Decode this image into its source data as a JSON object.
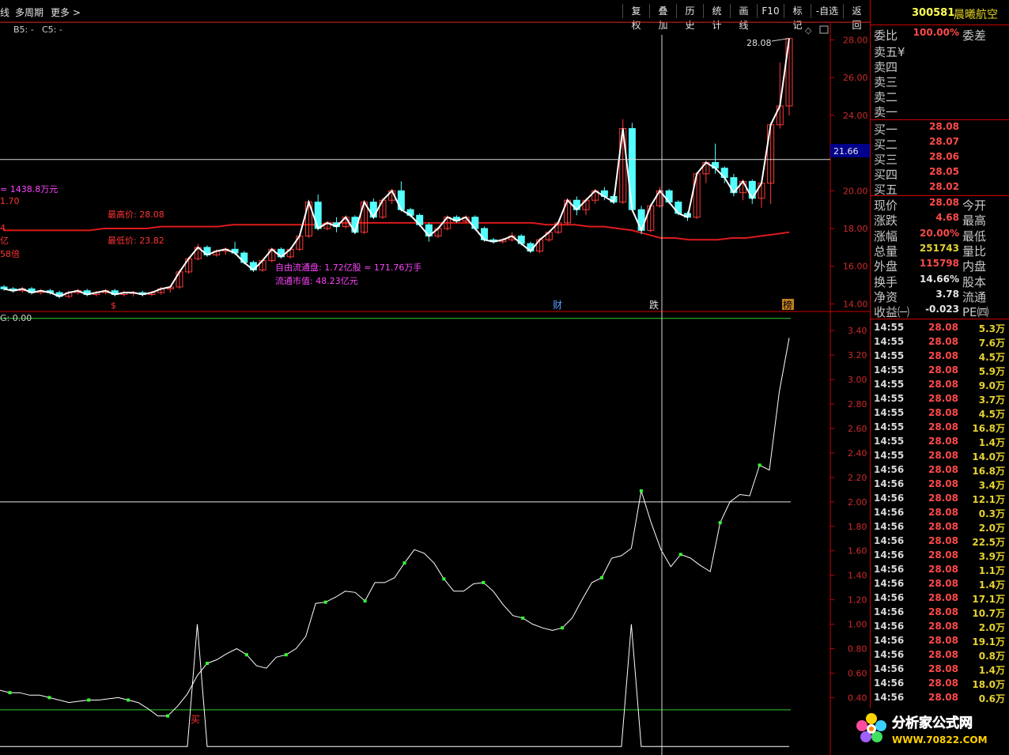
{
  "toolbar": {
    "left_items": [
      "线",
      "多周期",
      "更多 >"
    ],
    "buttons": [
      "复权",
      "叠加",
      "历史",
      "统计",
      "画线",
      "F10",
      "标记",
      "-自选",
      "返回"
    ]
  },
  "main_panel": {
    "indicator_header": [
      "B5: -",
      "C5: -"
    ],
    "crosshair_price_label": "21.66",
    "peak_label": "28.08",
    "annotations": {
      "amount": "= 1438.8万元",
      "amount_sub": "1.70",
      "high_price": "最高价: 28.08",
      "low_price": "最低价: 23.82",
      "free_float": "自由流通盘: 1.72亿股 ≈ 171.76万手",
      "float_mv": "流通市值: 48.23亿元",
      "left_clip_1": "亿",
      "left_clip_2": "58倍",
      "left_clip_3": "4"
    },
    "markers": [
      "$",
      "财",
      "跌",
      "榜"
    ]
  },
  "sub_panel": {
    "header": "G: 0.00",
    "buy_label": "买"
  },
  "chart_data": [
    {
      "type": "candlestick",
      "title": "",
      "ylim": [
        13.6,
        28.9
      ],
      "y_ticks": [
        14.0,
        16.0,
        18.0,
        20.0,
        22.0,
        24.0,
        26.0,
        28.0
      ],
      "candles": [
        [
          14.9,
          14.8,
          15.0,
          14.7
        ],
        [
          14.8,
          14.7,
          14.9,
          14.6
        ],
        [
          14.7,
          14.8,
          14.9,
          14.6
        ],
        [
          14.8,
          14.6,
          14.9,
          14.5
        ],
        [
          14.6,
          14.7,
          14.8,
          14.5
        ],
        [
          14.7,
          14.6,
          14.8,
          14.5
        ],
        [
          14.6,
          14.4,
          14.7,
          14.3
        ],
        [
          14.4,
          14.6,
          14.7,
          14.3
        ],
        [
          14.6,
          14.7,
          14.8,
          14.5
        ],
        [
          14.7,
          14.5,
          14.8,
          14.4
        ],
        [
          14.5,
          14.6,
          14.7,
          14.4
        ],
        [
          14.6,
          14.7,
          14.8,
          14.5
        ],
        [
          14.7,
          14.5,
          14.8,
          14.4
        ],
        [
          14.5,
          14.6,
          14.7,
          14.4
        ],
        [
          14.6,
          14.6,
          14.7,
          14.4
        ],
        [
          14.6,
          14.5,
          14.7,
          14.4
        ],
        [
          14.5,
          14.6,
          14.7,
          14.4
        ],
        [
          14.6,
          14.8,
          14.9,
          14.5
        ],
        [
          14.8,
          14.9,
          15.0,
          14.6
        ],
        [
          14.9,
          15.7,
          15.8,
          14.8
        ],
        [
          15.7,
          16.4,
          16.5,
          15.6
        ],
        [
          16.4,
          17.0,
          17.2,
          16.3
        ],
        [
          17.0,
          16.6,
          17.1,
          16.5
        ],
        [
          16.6,
          16.8,
          16.9,
          16.5
        ],
        [
          16.8,
          16.9,
          17.0,
          16.6
        ],
        [
          16.9,
          16.7,
          17.3,
          16.6
        ],
        [
          16.7,
          16.2,
          16.8,
          16.1
        ],
        [
          16.2,
          15.8,
          16.3,
          15.7
        ],
        [
          15.8,
          16.3,
          16.4,
          15.7
        ],
        [
          16.3,
          16.9,
          17.0,
          16.2
        ],
        [
          16.9,
          16.5,
          17.0,
          16.4
        ],
        [
          16.5,
          16.9,
          17.0,
          16.4
        ],
        [
          16.9,
          17.6,
          17.7,
          16.8
        ],
        [
          17.6,
          19.4,
          19.5,
          17.5
        ],
        [
          19.4,
          18.0,
          19.8,
          17.9
        ],
        [
          18.0,
          18.3,
          18.4,
          17.9
        ],
        [
          18.3,
          18.1,
          18.6,
          17.8
        ],
        [
          18.1,
          18.6,
          18.7,
          18.0
        ],
        [
          18.6,
          17.8,
          18.7,
          17.7
        ],
        [
          17.8,
          19.4,
          19.5,
          17.7
        ],
        [
          19.4,
          18.6,
          19.6,
          18.5
        ],
        [
          18.6,
          19.5,
          19.6,
          18.5
        ],
        [
          19.5,
          20.0,
          20.1,
          19.3
        ],
        [
          20.0,
          19.0,
          20.5,
          18.9
        ],
        [
          19.0,
          18.7,
          19.1,
          18.6
        ],
        [
          18.7,
          18.2,
          18.8,
          18.1
        ],
        [
          18.2,
          17.6,
          18.3,
          17.3
        ],
        [
          17.6,
          18.0,
          18.1,
          17.5
        ],
        [
          18.0,
          18.6,
          18.7,
          17.9
        ],
        [
          18.6,
          18.4,
          18.7,
          18.3
        ],
        [
          18.4,
          18.6,
          18.7,
          18.3
        ],
        [
          18.6,
          18.0,
          18.7,
          17.9
        ],
        [
          18.0,
          17.4,
          18.1,
          17.3
        ],
        [
          17.4,
          17.3,
          17.5,
          17.2
        ],
        [
          17.3,
          17.4,
          17.5,
          17.2
        ],
        [
          17.4,
          17.6,
          17.8,
          17.3
        ],
        [
          17.6,
          17.2,
          17.7,
          17.1
        ],
        [
          17.2,
          16.8,
          17.3,
          16.7
        ],
        [
          16.8,
          17.4,
          17.5,
          16.7
        ],
        [
          17.4,
          17.8,
          17.9,
          17.3
        ],
        [
          17.8,
          18.3,
          18.4,
          17.7
        ],
        [
          18.3,
          19.5,
          19.6,
          18.2
        ],
        [
          19.5,
          19.0,
          19.7,
          18.7
        ],
        [
          19.0,
          19.5,
          19.6,
          18.7
        ],
        [
          19.5,
          20.0,
          20.1,
          19.3
        ],
        [
          20.0,
          19.7,
          20.2,
          19.5
        ],
        [
          19.7,
          19.4,
          19.8,
          19.3
        ],
        [
          19.4,
          23.3,
          23.8,
          19.3
        ],
        [
          23.3,
          19.0,
          23.6,
          18.9
        ],
        [
          19.0,
          17.9,
          19.2,
          17.7
        ],
        [
          17.9,
          19.2,
          19.3,
          17.8
        ],
        [
          19.2,
          20.0,
          20.2,
          19.1
        ],
        [
          20.0,
          19.4,
          20.1,
          19.3
        ],
        [
          19.4,
          18.8,
          19.5,
          18.7
        ],
        [
          18.8,
          18.6,
          18.9,
          18.4
        ],
        [
          18.6,
          20.9,
          21.0,
          18.5
        ],
        [
          20.9,
          21.5,
          21.6,
          20.4
        ],
        [
          21.5,
          21.2,
          22.5,
          20.9
        ],
        [
          21.2,
          20.7,
          21.3,
          20.4
        ],
        [
          20.7,
          19.9,
          20.9,
          19.7
        ],
        [
          19.9,
          20.5,
          20.6,
          19.5
        ],
        [
          20.5,
          19.6,
          20.6,
          19.3
        ],
        [
          19.6,
          20.4,
          20.5,
          19.1
        ],
        [
          20.4,
          23.5,
          23.6,
          19.3
        ],
        [
          23.5,
          24.5,
          26.8,
          23.3
        ],
        [
          24.5,
          28.08,
          28.08,
          24.0
        ]
      ],
      "ma_line": [
        17.9,
        17.9,
        17.9,
        17.9,
        17.9,
        17.9,
        17.9,
        18.0,
        18.0,
        18.0,
        18.0,
        18.1,
        18.1,
        18.1,
        18.1,
        18.1,
        18.2,
        18.2,
        18.2,
        18.2,
        18.2,
        18.2,
        18.2,
        18.3,
        18.3,
        18.3,
        18.3,
        18.3,
        18.3,
        18.3,
        18.3,
        18.3,
        18.3,
        18.3,
        18.3,
        18.3,
        18.3,
        18.3,
        18.2,
        18.2,
        18.2,
        18.1,
        18.1,
        18.0,
        17.9,
        17.7,
        17.5,
        17.5,
        17.4,
        17.4,
        17.4,
        17.5,
        17.5,
        17.6,
        17.7,
        17.8
      ],
      "crosshair_price": 21.66
    },
    {
      "type": "line",
      "title": "",
      "ylim": [
        -0.05,
        3.55
      ],
      "y_ticks": [
        0.4,
        0.6,
        0.8,
        1.0,
        1.2,
        1.4,
        1.6,
        1.8,
        2.0,
        2.2,
        2.4,
        2.6,
        2.8,
        3.0,
        3.2,
        3.4
      ],
      "threshold_lines": [
        3.5,
        2.0,
        0.3
      ],
      "series": [
        {
          "values": [
            0.46,
            0.44,
            0.44,
            0.42,
            0.42,
            0.4,
            0.38,
            0.36,
            0.37,
            0.38,
            0.38,
            0.39,
            0.4,
            0.38,
            0.36,
            0.31,
            0.25,
            0.25,
            0.33,
            0.43,
            0.58,
            0.68,
            0.71,
            0.76,
            0.8,
            0.75,
            0.66,
            0.64,
            0.73,
            0.75,
            0.8,
            0.9,
            1.17,
            1.18,
            1.22,
            1.27,
            1.26,
            1.19,
            1.34,
            1.34,
            1.38,
            1.5,
            1.61,
            1.58,
            1.5,
            1.37,
            1.27,
            1.27,
            1.33,
            1.34,
            1.27,
            1.16,
            1.07,
            1.05,
            1.0,
            0.97,
            0.95,
            0.97,
            1.05,
            1.2,
            1.34,
            1.38,
            1.54,
            1.56,
            1.62,
            2.09,
            1.83,
            1.61,
            1.47,
            1.57,
            1.54,
            1.48,
            1.43,
            1.83,
            2.0,
            2.06,
            2.05,
            2.3,
            2.26,
            2.9,
            3.34
          ]
        },
        {
          "values": [
            0,
            0,
            0,
            0,
            0,
            0,
            0,
            0,
            0,
            0,
            0,
            0,
            0,
            0,
            0,
            0,
            0,
            0,
            0,
            0,
            1.0,
            0,
            0,
            0,
            0,
            0,
            0,
            0,
            0,
            0,
            0,
            0,
            0,
            0,
            0,
            0,
            0,
            0,
            0,
            0,
            0,
            0,
            0,
            0,
            0,
            0,
            0,
            0,
            0,
            0,
            0,
            0,
            0,
            0,
            0,
            0,
            0,
            0,
            0,
            0,
            0,
            0,
            0,
            0,
            1.0,
            0,
            0,
            0,
            0,
            0,
            0,
            0,
            0,
            0,
            0,
            0,
            0,
            0,
            0,
            0,
            0
          ]
        }
      ]
    }
  ],
  "quote": {
    "code": "300581",
    "name": "晨曦航空",
    "ratio_label": "委比",
    "ratio_value": "100.00%",
    "diff_label": "委差",
    "asks": [
      {
        "label": "卖五",
        "extra": "¥",
        "value": ""
      },
      {
        "label": "卖四",
        "value": ""
      },
      {
        "label": "卖三",
        "value": ""
      },
      {
        "label": "卖二",
        "value": ""
      },
      {
        "label": "卖一",
        "value": ""
      }
    ],
    "bids": [
      {
        "label": "买一",
        "value": "28.08"
      },
      {
        "label": "买二",
        "value": "28.07"
      },
      {
        "label": "买三",
        "value": "28.06"
      },
      {
        "label": "买四",
        "value": "28.05"
      },
      {
        "label": "买五",
        "value": "28.02"
      }
    ],
    "stats": [
      {
        "l1": "现价",
        "v": "28.08",
        "c": "#ff4a4a",
        "l2": "今开"
      },
      {
        "l1": "涨跌",
        "v": "4.68",
        "c": "#ff4a4a",
        "l2": "最高"
      },
      {
        "l1": "涨幅",
        "v": "20.00%",
        "c": "#ff4a4a",
        "l2": "最低"
      },
      {
        "l1": "总量",
        "v": "251743",
        "c": "#e6d230",
        "l2": "量比"
      },
      {
        "l1": "外盘",
        "v": "115798",
        "c": "#ff4a4a",
        "l2": "内盘"
      },
      {
        "l1": "换手",
        "v": "14.66%",
        "c": "#e6e6e6",
        "l2": "股本"
      },
      {
        "l1": "净资",
        "v": "3.78",
        "c": "#e6e6e6",
        "l2": "流通"
      },
      {
        "l1": "收益㈠",
        "v": "-0.023",
        "c": "#e6e6e6",
        "l2": "PE㈣"
      }
    ],
    "ticks": [
      [
        "14:55",
        "28.08",
        "5.3万"
      ],
      [
        "14:55",
        "28.08",
        "7.6万"
      ],
      [
        "14:55",
        "28.08",
        "4.5万"
      ],
      [
        "14:55",
        "28.08",
        "5.9万"
      ],
      [
        "14:55",
        "28.08",
        "9.0万"
      ],
      [
        "14:55",
        "28.08",
        "3.7万"
      ],
      [
        "14:55",
        "28.08",
        "4.5万"
      ],
      [
        "14:55",
        "28.08",
        "16.8万"
      ],
      [
        "14:55",
        "28.08",
        "1.4万"
      ],
      [
        "14:55",
        "28.08",
        "14.0万"
      ],
      [
        "14:56",
        "28.08",
        "16.8万"
      ],
      [
        "14:56",
        "28.08",
        "3.4万"
      ],
      [
        "14:56",
        "28.08",
        "12.1万"
      ],
      [
        "14:56",
        "28.08",
        "0.3万"
      ],
      [
        "14:56",
        "28.08",
        "2.0万"
      ],
      [
        "14:56",
        "28.08",
        "22.5万"
      ],
      [
        "14:56",
        "28.08",
        "3.9万"
      ],
      [
        "14:56",
        "28.08",
        "1.1万"
      ],
      [
        "14:56",
        "28.08",
        "1.4万"
      ],
      [
        "14:56",
        "28.08",
        "17.1万"
      ],
      [
        "14:56",
        "28.08",
        "10.7万"
      ],
      [
        "14:56",
        "28.08",
        "2.0万"
      ],
      [
        "14:56",
        "28.08",
        "19.1万"
      ],
      [
        "14:56",
        "28.08",
        "0.8万"
      ],
      [
        "14:56",
        "28.08",
        "1.4万"
      ],
      [
        "14:56",
        "28.08",
        "18.0万"
      ],
      [
        "14:56",
        "28.08",
        "0.6万"
      ]
    ]
  },
  "logo": {
    "text": "分析家公式网",
    "url_text": "WWW.70822.COM"
  }
}
